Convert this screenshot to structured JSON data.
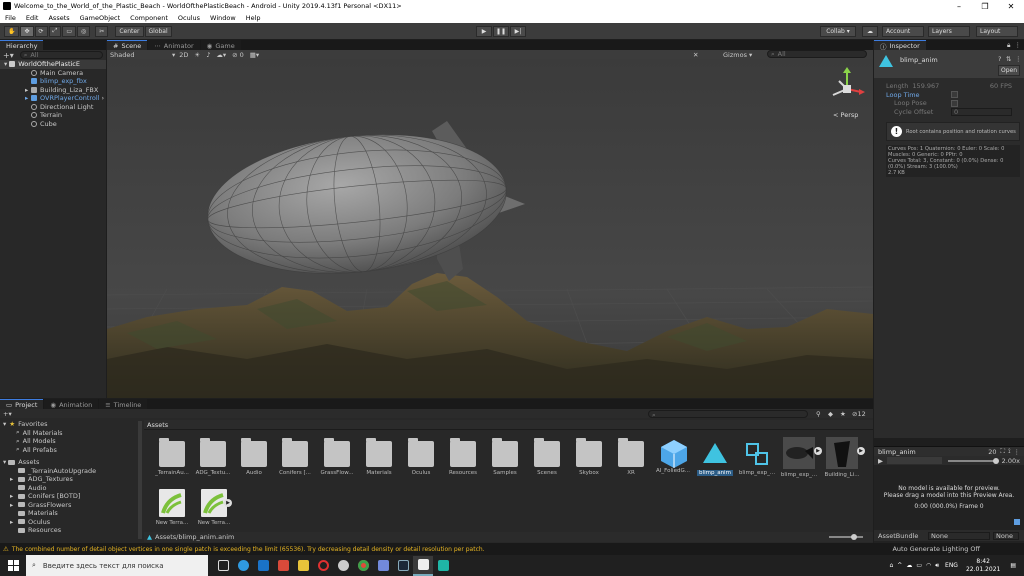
{
  "window": {
    "title": "Welcome_to_the_World_of_the_Plastic_Beach - WorldOfthePlasticBeach - Android - Unity 2019.4.13f1 Personal <DX11>"
  },
  "menu": [
    "File",
    "Edit",
    "Assets",
    "GameObject",
    "Component",
    "Oculus",
    "Window",
    "Help"
  ],
  "toolbar": {
    "center": "Center",
    "global": "Global",
    "collab": "Collab ▾",
    "account": "Account",
    "layers": "Layers",
    "layout": "Layout"
  },
  "hierarchy": {
    "tab": "Hierarchy",
    "search": "All",
    "scene": "WorldOfthePlasticE",
    "items": [
      "Main Camera",
      "blimp_exp_fbx",
      "Building_Liza_FBX",
      "OVRPlayerControll",
      "Directional Light",
      "Terrain",
      "Cube"
    ]
  },
  "scene": {
    "tabs": [
      "Scene",
      "Animator",
      "Game"
    ],
    "shading": "Shaded",
    "mode2d": "2D",
    "fx_count": "0",
    "gizmos": "Gizmos",
    "search": "All",
    "persp": "< Persp"
  },
  "inspector": {
    "tab": "Inspector",
    "name": "blimp_anim",
    "open": "Open",
    "length_label": "Length",
    "length_value": "159.967",
    "fps": "60 FPS",
    "loop_time": "Loop Time",
    "loop_pose": "Loop Pose",
    "cycle_offset": "Cycle Offset",
    "cycle_value": "0",
    "info": "Root contains position and rotation curves",
    "stats": [
      "Curves Pos: 1 Quaternion: 0 Euler: 0 Scale: 0",
      "Muscles: 0 Generic: 0 PPtr: 0",
      "Curves Total: 3, Constant: 0 (0.0%) Dense: 0",
      "(0.0%) Stream: 3 (100.0%)",
      "2.7 KB"
    ]
  },
  "preview": {
    "name": "blimp_anim",
    "frame_count": "20",
    "speed": "2.00x",
    "msg1": "No model is available for preview.",
    "msg2": "Please drag a model into this Preview Area.",
    "frame": "0:00 (000.0%) Frame 0",
    "bundle_label": "AssetBundle",
    "bundle_value": "None",
    "variant_value": "None"
  },
  "project": {
    "tabs": [
      "Project",
      "Animation",
      "Timeline"
    ],
    "badge": "12",
    "favorites": "Favorites",
    "fav_items": [
      "All Materials",
      "All Models",
      "All Prefabs"
    ],
    "assets_root": "Assets",
    "tree": [
      "_TerrainAutoUpgrade",
      "ADG_Textures",
      "Audio",
      "Conifers [BOTD]",
      "GrassFlowers",
      "Materials",
      "Oculus",
      "Resources"
    ],
    "breadcrumb": "Assets",
    "path": "Assets/blimp_anim.anim"
  },
  "assets": [
    {
      "label": "_TerrainAu...",
      "kind": "folder"
    },
    {
      "label": "ADG_Textu...",
      "kind": "folder"
    },
    {
      "label": "Audio",
      "kind": "folder"
    },
    {
      "label": "Conifers [...",
      "kind": "folder"
    },
    {
      "label": "GrassFlow...",
      "kind": "folder"
    },
    {
      "label": "Materials",
      "kind": "folder"
    },
    {
      "label": "Oculus",
      "kind": "folder"
    },
    {
      "label": "Resources",
      "kind": "folder"
    },
    {
      "label": "Samples",
      "kind": "folder"
    },
    {
      "label": "Scenes",
      "kind": "folder"
    },
    {
      "label": "Skybox",
      "kind": "folder"
    },
    {
      "label": "XR",
      "kind": "folder"
    },
    {
      "label": "AI_FoliedG...",
      "kind": "package"
    },
    {
      "label": "blimp_anim",
      "kind": "anim"
    },
    {
      "label": "blimp_exp_...",
      "kind": "prefab"
    },
    {
      "label": "blimp_exp_...",
      "kind": "model"
    },
    {
      "label": "Building_Li...",
      "kind": "model2"
    },
    {
      "label": "New Terra...",
      "kind": "terrain"
    },
    {
      "label": "New Terra...",
      "kind": "terrain"
    }
  ],
  "status": {
    "warning": "The combined number of detail object vertices in one single patch is exceeding the limit (65536). Try decreasing detail density or detail resolution per patch.",
    "lighting": "Auto Generate Lighting Off"
  },
  "taskbar": {
    "search": "Введите здесь текст для поиска",
    "lang": "ENG",
    "time": "8:42",
    "date": "22.01.2021"
  },
  "colors": {
    "accent": "#3e7de0",
    "warning": "#e8b622",
    "selection": "#2c5d87"
  }
}
